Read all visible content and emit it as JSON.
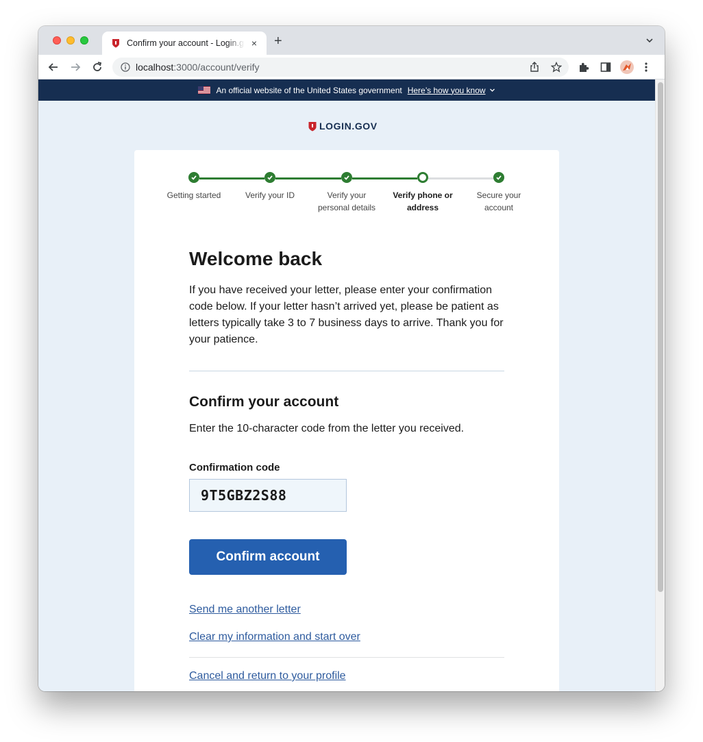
{
  "browser": {
    "tab_title": "Confirm your account - Login.gov",
    "url_host": "localhost",
    "url_path": ":3000/account/verify",
    "new_tab": "+",
    "close_tab": "×"
  },
  "banner": {
    "text": "An official website of the United States government",
    "link": "Here’s how you know"
  },
  "logo": {
    "text": "LOGIN.GOV"
  },
  "steps": [
    {
      "label": "Getting started",
      "status": "complete"
    },
    {
      "label": "Verify your ID",
      "status": "complete"
    },
    {
      "label": "Verify your personal details",
      "status": "complete"
    },
    {
      "label": "Verify phone or address",
      "status": "current"
    },
    {
      "label": "Secure your account",
      "status": "complete"
    }
  ],
  "main": {
    "heading": "Welcome back",
    "intro": "If you have received your letter, please enter your confirmation code below. If your letter hasn’t arrived yet, please be patient as letters typically take 3 to 7 business days to arrive. Thank you for your patience.",
    "confirm_heading": "Confirm your account",
    "confirm_desc": "Enter the 10-character code from the letter you received.",
    "code_label": "Confirmation code",
    "code_value": "9T5GBZ2S88",
    "confirm_button": "Confirm account",
    "send_letter_link": "Send me another letter",
    "clear_link": "Clear my information and start over",
    "cancel_link": "Cancel and return to your profile"
  },
  "colors": {
    "banner_bg": "#162e51",
    "page_bg": "#e8f0f8",
    "success_green": "#2e7d32",
    "primary_button": "#2560b0",
    "link": "#2e5b9e"
  }
}
